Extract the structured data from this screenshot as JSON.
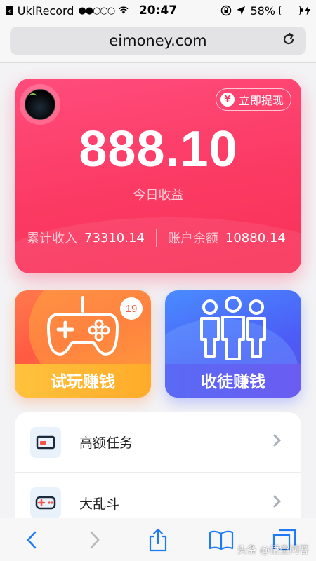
{
  "status_bar": {
    "carrier": "UkiRecord",
    "signal": "●●○○○",
    "time": "20:47",
    "battery_percent": "58%",
    "battery_level": 0.58
  },
  "browser": {
    "url": "eimoney.com"
  },
  "earnings": {
    "withdraw_label": "立即提现",
    "amount": "888.10",
    "today_label": "今日收益",
    "total_income_label": "累计收入",
    "total_income_value": "73310.14",
    "balance_label": "账户余额",
    "balance_value": "10880.14"
  },
  "tiles": {
    "play": {
      "label": "试玩赚钱",
      "badge": "19"
    },
    "recruit": {
      "label": "收徒赚钱"
    }
  },
  "list": [
    {
      "label": "高额任务",
      "icon": "card-icon"
    },
    {
      "label": "大乱斗",
      "icon": "gamepad-icon"
    }
  ],
  "watermark": "头条 @悟空问答",
  "colors": {
    "card_primary": "#fb3a63",
    "play_tile": "#ff7a4c",
    "recruit_tile": "#4c5cf6",
    "ios_blue": "#1d7cf5"
  }
}
